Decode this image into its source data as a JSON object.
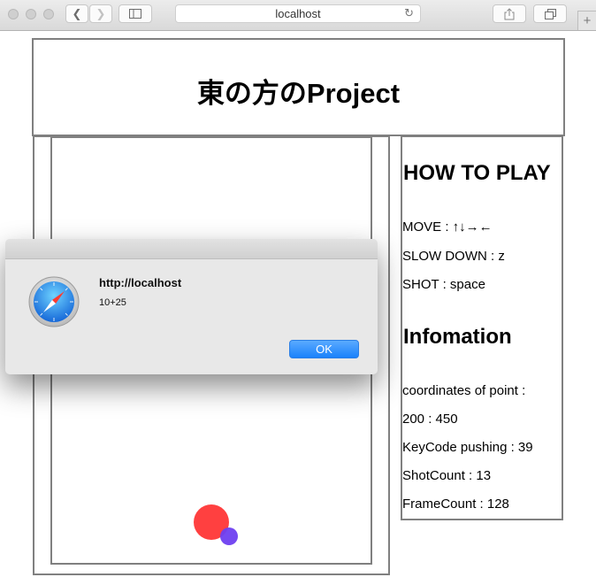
{
  "browser": {
    "url": "localhost"
  },
  "page": {
    "title": "東の方のProject"
  },
  "how_to_play": {
    "heading": "HOW TO PLAY",
    "move": "MOVE : ↑↓→←",
    "slow_down": "SLOW DOWN : z",
    "shot": "SHOT : space"
  },
  "information": {
    "heading": "Infomation",
    "coordinates_label": "coordinates of point :",
    "coordinates_value": "200 : 450",
    "keycode": "KeyCode pushing : 39",
    "shot_count": "ShotCount : 13",
    "frame_count": "FrameCount : 128"
  },
  "dialog": {
    "title": "http://localhost",
    "message": "10+25",
    "ok_label": "OK"
  }
}
